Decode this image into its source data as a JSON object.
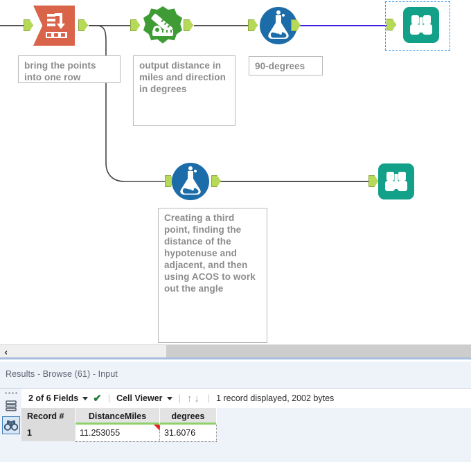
{
  "canvas": {
    "tools": [
      {
        "id": "transpose",
        "name": "transpose-tool",
        "icon": "transpose-icon",
        "color": "#d9644a"
      },
      {
        "id": "distance",
        "name": "distance-tool",
        "icon": "ruler-distance-icon",
        "color": "#3f9c35"
      },
      {
        "id": "formula-top",
        "name": "formula-tool",
        "icon": "flask-formula-icon",
        "color": "#1b6ca8"
      },
      {
        "id": "browse-top",
        "name": "browse-tool",
        "icon": "binoculars-icon",
        "color": "#13a089",
        "selected": true
      },
      {
        "id": "formula-bottom",
        "name": "formula-tool",
        "icon": "flask-formula-icon",
        "color": "#1b6ca8"
      },
      {
        "id": "browse-bottom",
        "name": "browse-tool",
        "icon": "binoculars-icon",
        "color": "#13a089"
      }
    ],
    "annotations": [
      {
        "id": "note1",
        "text": "bring the points into one row"
      },
      {
        "id": "note2",
        "text": "output distance in miles and direction in degrees"
      },
      {
        "id": "note3",
        "text": "90-degrees"
      },
      {
        "id": "note4",
        "text": "Creating a third point, finding the distance of the hypotenuse and adjacent, and then using ACOS to work out the angle"
      }
    ]
  },
  "scrollbar": {
    "left_arrow": "‹"
  },
  "results": {
    "title": "Results - Browse (61) - Input",
    "rail": {
      "rows_icon": "data-rows-icon",
      "browse_icon": "binoculars-icon"
    },
    "toolbar": {
      "fields_label": "2 of 6 Fields",
      "check_glyph": "✔",
      "viewer_label": "Cell Viewer",
      "up_glyph": "↑",
      "down_glyph": "↓",
      "separator": "|",
      "status": "1 record displayed, 2002 bytes"
    },
    "table": {
      "columns": [
        "Record #",
        "DistanceMiles",
        "degrees"
      ],
      "rows": [
        {
          "record": "1",
          "DistanceMiles": "11.253055",
          "degrees": "31.6076"
        }
      ]
    }
  },
  "colors": {
    "transpose": "#d9644a",
    "distance": "#3f9c35",
    "formula": "#1b6ca8",
    "browse": "#13a089",
    "anchor": "#b6d957",
    "wire": "#555555",
    "wire_selected": "#3a1fd8",
    "selection": "#2f8fe0",
    "header_underline": "#8ed16b",
    "panel_bg": "#eef2f9"
  }
}
